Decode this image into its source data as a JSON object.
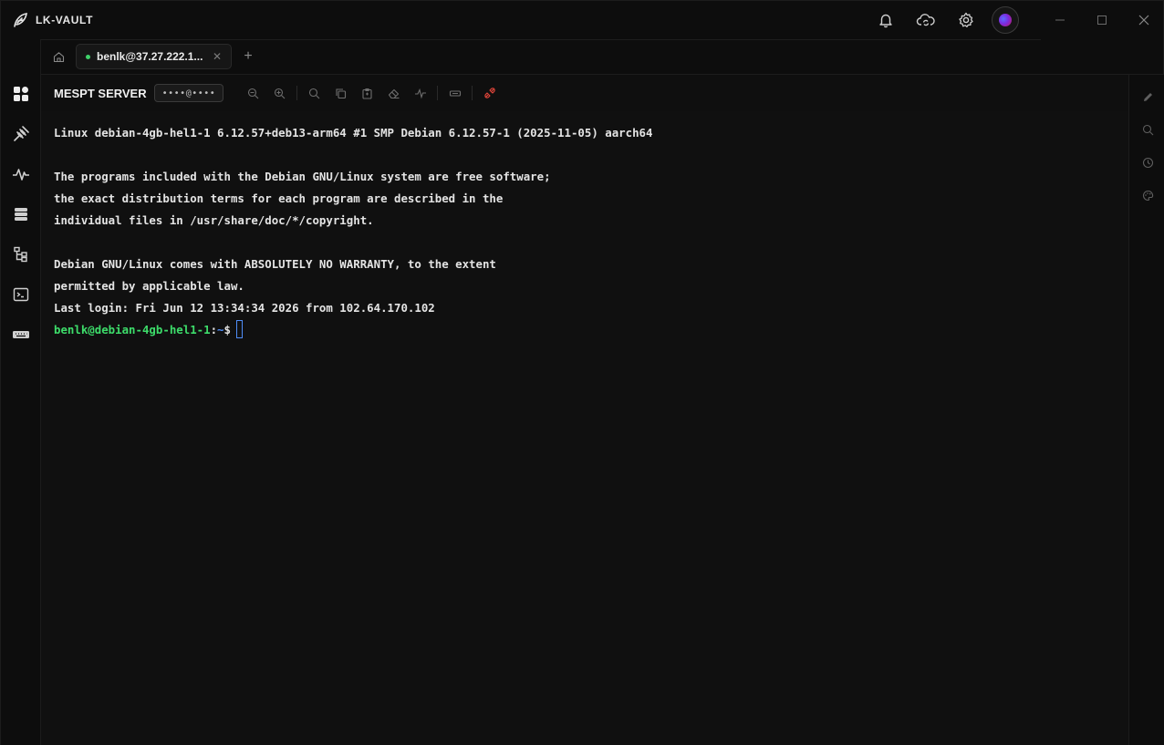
{
  "app": {
    "name": "LK-VAULT"
  },
  "titlebar": {
    "actions": [
      {
        "name": "bell-icon"
      },
      {
        "name": "cloud-sync-icon"
      },
      {
        "name": "gear-icon"
      }
    ]
  },
  "tabs": [
    {
      "label": "benlk@37.27.222.1...",
      "status_color": "#3fd16a",
      "active": true
    }
  ],
  "toolbar": {
    "server_name": "MESPT SERVER",
    "credential_masked": "••••@••••"
  },
  "terminal": {
    "lines": [
      "Linux debian-4gb-hel1-1 6.12.57+deb13-arm64 #1 SMP Debian 6.12.57-1 (2025-11-05) aarch64",
      "",
      "The programs included with the Debian GNU/Linux system are free software;",
      "the exact distribution terms for each program are described in the",
      "individual files in /usr/share/doc/*/copyright.",
      "",
      "Debian GNU/Linux comes with ABSOLUTELY NO WARRANTY, to the extent",
      "permitted by applicable law.",
      "Last login: Fri Jun 12 13:34:34 2026 from 102.64.170.102"
    ],
    "prompt": {
      "user_host": "benlk@debian-4gb-hel1-1",
      "sep": ":",
      "path": "~",
      "sign": "$"
    }
  },
  "colors": {
    "accent_green": "#3fd16a",
    "accent_blue": "#4f8df7",
    "danger": "#e0453a"
  }
}
